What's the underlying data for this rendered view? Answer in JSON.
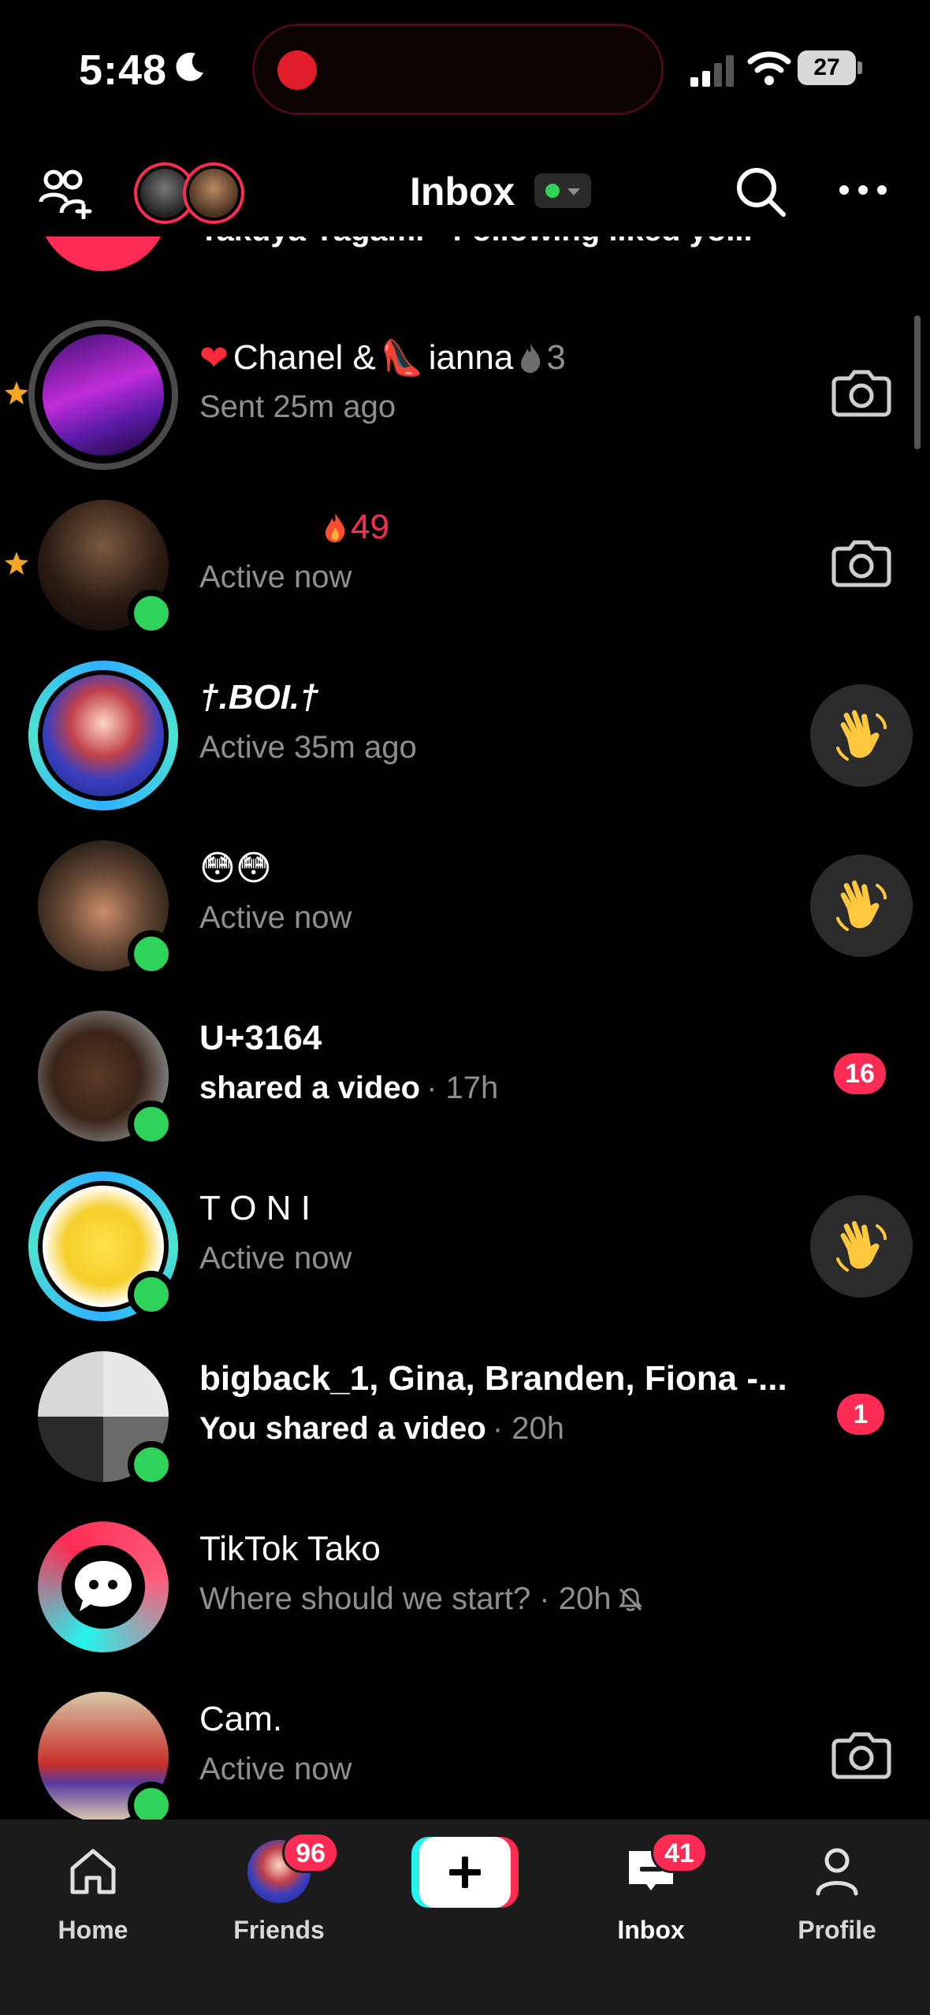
{
  "status_bar": {
    "time": "5:48",
    "battery": "27"
  },
  "header": {
    "title": "Inbox"
  },
  "partial_row": {
    "text": "Takuya Yagami • Following liked yo..."
  },
  "rows": [
    {
      "name": "Chanel & ",
      "name2": "ianna",
      "streak": "3",
      "subtitle": "Sent 25m ago",
      "action": "camera"
    },
    {
      "name": "",
      "streak": "49",
      "subtitle": "Active now",
      "action": "camera"
    },
    {
      "name": "†.BOI.†",
      "subtitle": "Active 35m ago",
      "action": "wave"
    },
    {
      "name": "😳😳",
      "subtitle": "Active now",
      "action": "wave"
    },
    {
      "name": "U+3164",
      "subtitle_strong": "shared a video",
      "subtitle_time": "· 17h",
      "badge": "16"
    },
    {
      "name": "T O N I",
      "subtitle": "Active now",
      "action": "wave"
    },
    {
      "name": "bigback_1, Gina, Branden, Fiona -...",
      "subtitle_strong": "You shared a video",
      "subtitle_time": "· 20h",
      "badge": "1"
    },
    {
      "name": "TikTok Tako",
      "subtitle": "Where should we start? · 20h"
    },
    {
      "name": "Cam.",
      "subtitle": "Active now",
      "action": "camera"
    }
  ],
  "tabbar": {
    "home": "Home",
    "friends": "Friends",
    "friends_badge": "96",
    "inbox": "Inbox",
    "inbox_badge": "41",
    "profile": "Profile"
  },
  "colors": {
    "accent": "#fe2c55",
    "online": "#2fd35a",
    "teal": "#25f4ee",
    "background": "#000000"
  }
}
